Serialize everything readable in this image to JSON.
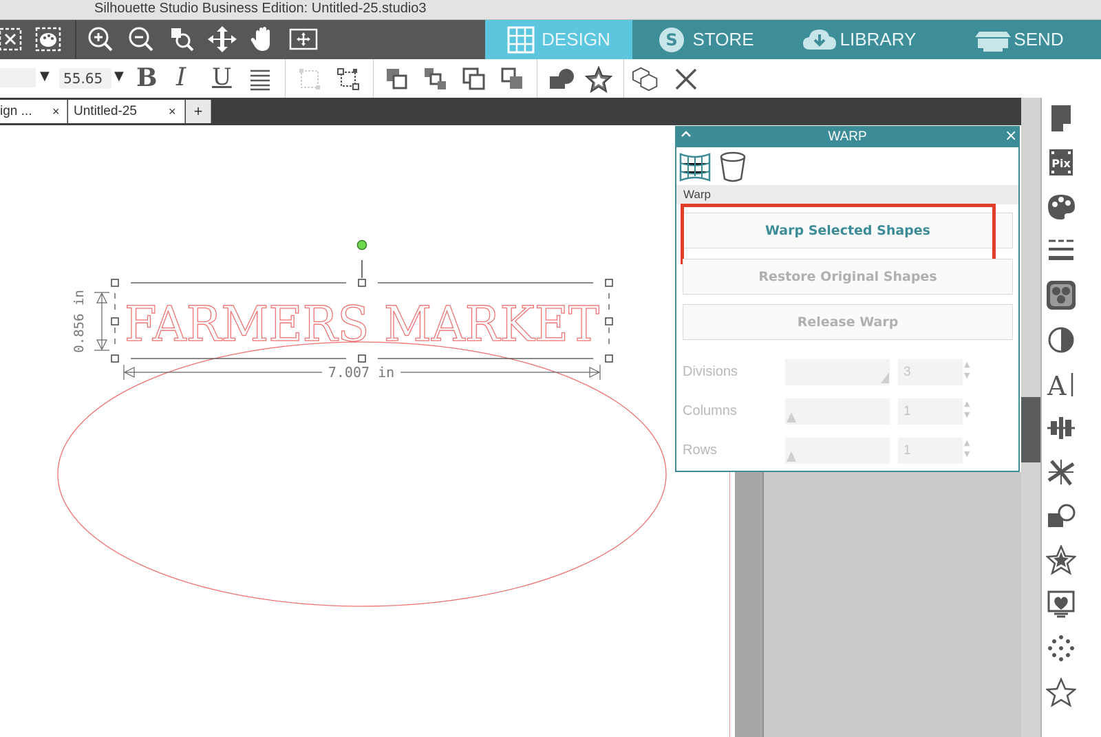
{
  "window": {
    "title": "Silhouette Studio Business Edition: Untitled-25.studio3"
  },
  "nav_tabs": [
    {
      "label": "DESIGN",
      "active": true
    },
    {
      "label": "STORE"
    },
    {
      "label": "LIBRARY"
    },
    {
      "label": "SEND"
    }
  ],
  "text_toolbar": {
    "font_size": "55.65",
    "bold": "B",
    "italic": "I",
    "underline": "U"
  },
  "doc_tabs": [
    {
      "label": "ign ...",
      "close": "×"
    },
    {
      "label": "Untitled-25",
      "close": "×"
    }
  ],
  "add_tab": "+",
  "canvas": {
    "text": "FARMERS MARKET",
    "height_dim": "0.856 in",
    "width_dim": "7.007 in"
  },
  "warp_panel": {
    "title": "WARP",
    "close": "×",
    "section_label": "Warp",
    "buttons": {
      "warp_selected": "Warp Selected Shapes",
      "restore": "Restore Original Shapes",
      "release": "Release Warp"
    },
    "fields": [
      {
        "label": "Divisions",
        "value": "3"
      },
      {
        "label": "Columns",
        "value": "1"
      },
      {
        "label": "Rows",
        "value": "1"
      }
    ]
  },
  "right_icons": [
    "page-setup-icon",
    "pixscan-icon",
    "fill-color-icon",
    "line-style-icon",
    "image-effects-icon",
    "contrast-icon",
    "text-style-icon",
    "align-icon",
    "replicate-icon",
    "modify-icon",
    "offset-icon",
    "trace-icon",
    "sketch-icon",
    "rhinestone-icon"
  ],
  "colors": {
    "accent": "#3c8c98",
    "design_tab": "#5bc6de",
    "highlight": "#e23c2a",
    "shape_stroke": "#f07070"
  }
}
